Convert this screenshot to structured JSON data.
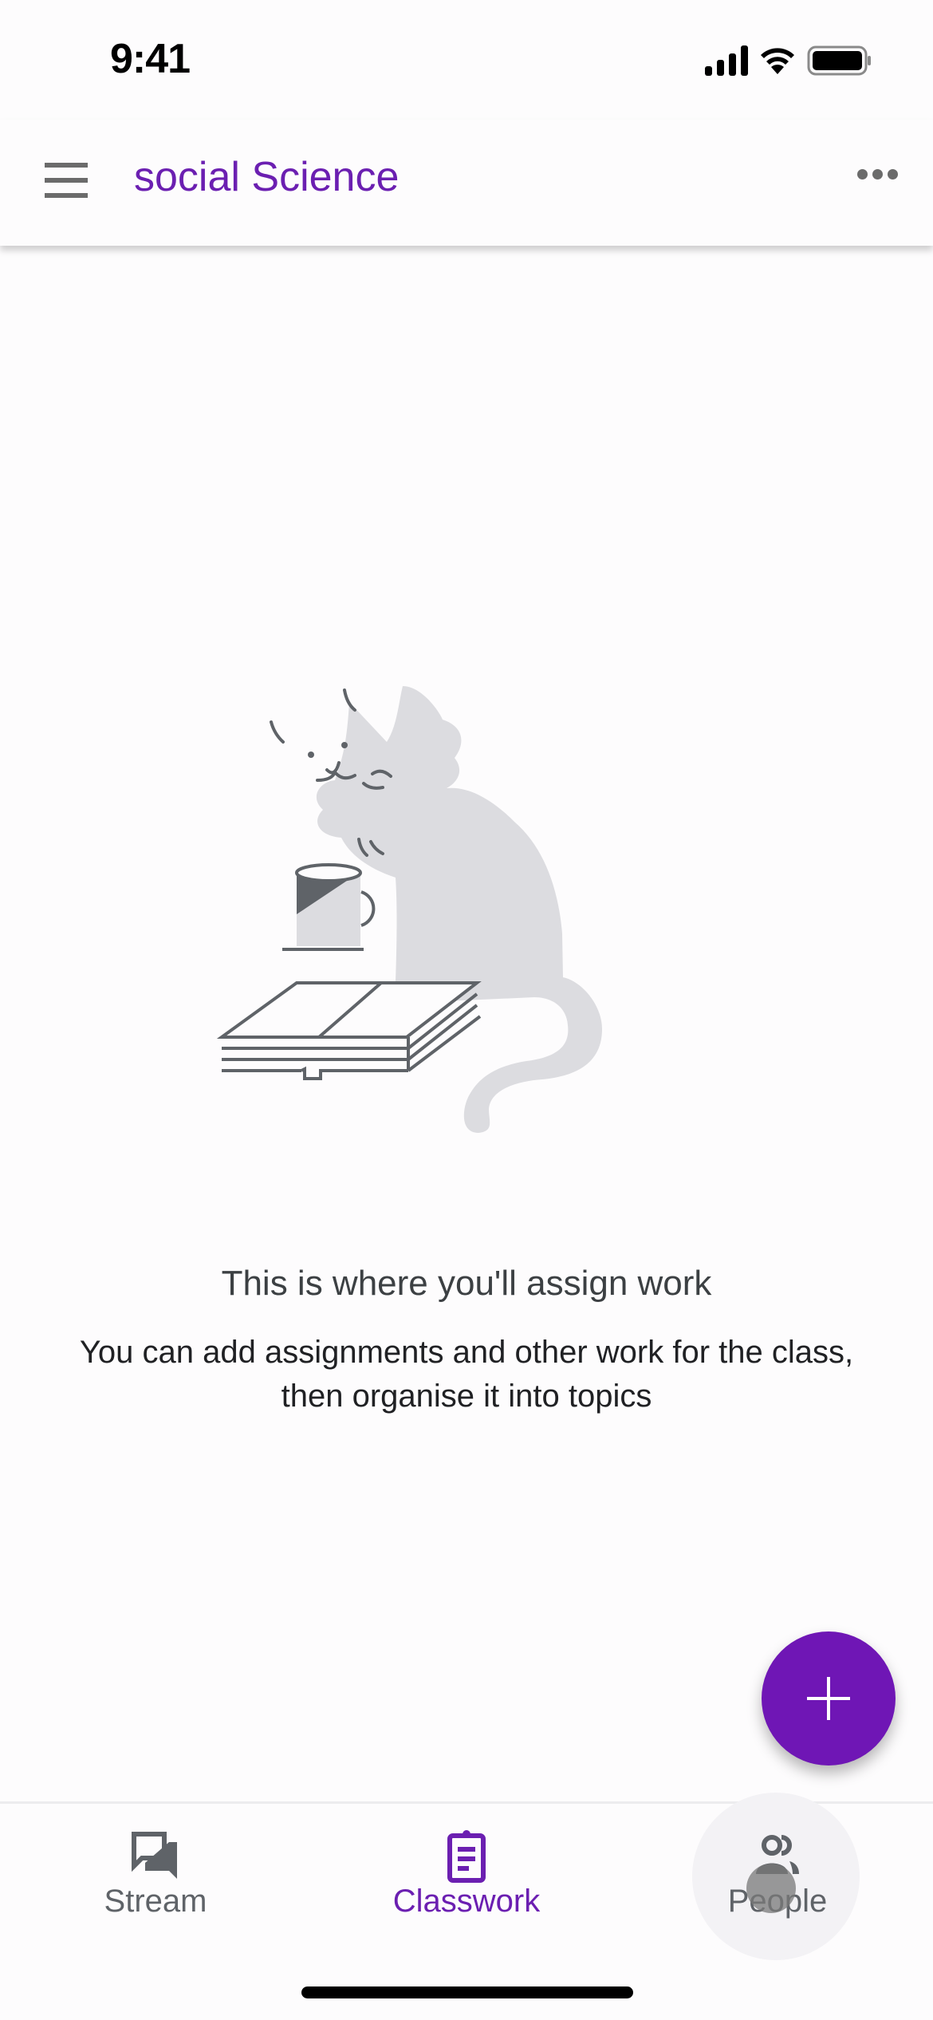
{
  "status_bar": {
    "time": "9:41",
    "icons": [
      "cellular-signal-icon",
      "wifi-icon",
      "battery-icon"
    ]
  },
  "app_bar": {
    "title": "social Science",
    "menu_icon": "hamburger-menu-icon",
    "more_icon": "more-horizontal-icon"
  },
  "empty_state": {
    "illustration": "cat-with-mug-and-book",
    "title": "This is where you'll assign work",
    "subtitle": "You can add assignments and other work for the class, then organise it into topics"
  },
  "fab": {
    "icon": "plus-icon",
    "color": "#6f16b5"
  },
  "bottom_nav": {
    "items": [
      {
        "label": "Stream",
        "icon": "stream-chat-icon",
        "active": false
      },
      {
        "label": "Classwork",
        "icon": "classwork-clipboard-icon",
        "active": true
      },
      {
        "label": "People",
        "icon": "people-icon",
        "active": false
      }
    ]
  },
  "colors": {
    "accent": "#6b1fb1",
    "icon_gray": "#5f6368",
    "illustration_fill": "#dcdce0",
    "illustration_stroke": "#5f6368"
  }
}
